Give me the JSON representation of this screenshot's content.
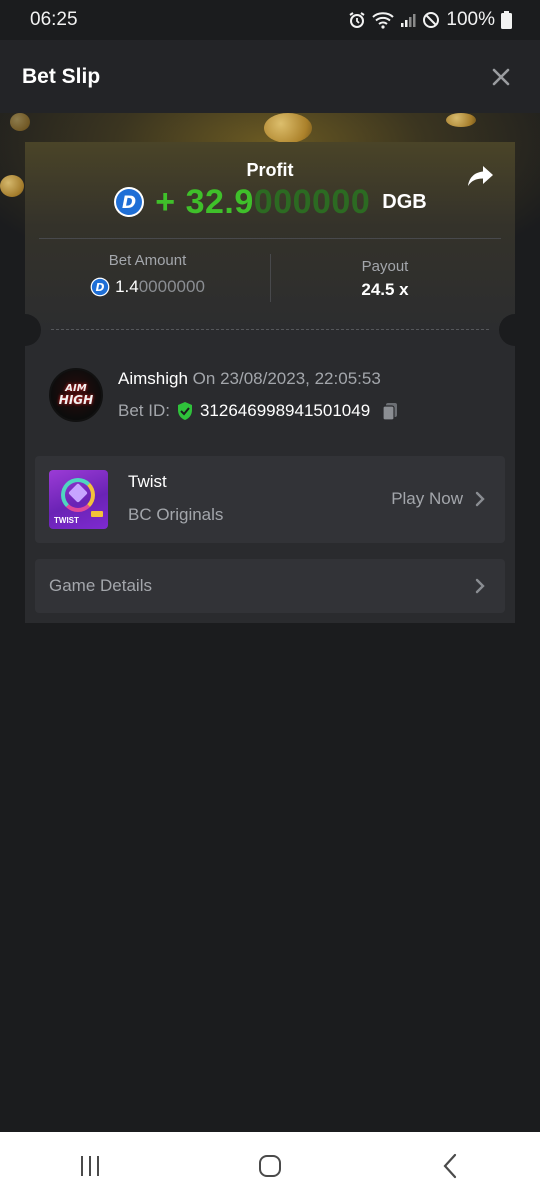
{
  "status_bar": {
    "time": "06:25",
    "battery": "100%",
    "icons": [
      "alarm-icon",
      "wifi-icon",
      "signal-icon",
      "do-not-disturb-icon",
      "battery-icon"
    ]
  },
  "header": {
    "title": "Bet Slip",
    "close_icon": "close-icon"
  },
  "profit": {
    "label": "Profit",
    "sign": "+ ",
    "value_bright": "32.9",
    "value_dim": "000000",
    "currency": "DGB",
    "coin_icon": "dgb-coin-icon",
    "share_icon": "share-icon"
  },
  "bet": {
    "amount_label": "Bet Amount",
    "amount_bright": "1.4",
    "amount_dim": "0000000",
    "payout_label": "Payout",
    "payout_value": "24.5 x"
  },
  "user": {
    "avatar_text_1": "AIM",
    "avatar_text_2": "HIGH",
    "name": "Aimshigh",
    "on_label": "On",
    "datetime": "23/08/2023, 22:05:53",
    "bet_id_label": "Bet ID:",
    "bet_id": "312646998941501049",
    "verified_icon": "shield-check-icon",
    "copy_icon": "copy-icon"
  },
  "game": {
    "name": "Twist",
    "provider": "BC Originals",
    "thumb_label": "TWIST",
    "play_label": "Play Now"
  },
  "details": {
    "label": "Game Details"
  },
  "colors": {
    "profit_green": "#3fc02a",
    "background": "#1b1c1e",
    "card": "#2a2b2e",
    "row": "#323337",
    "muted_text": "#a3a6ab"
  }
}
